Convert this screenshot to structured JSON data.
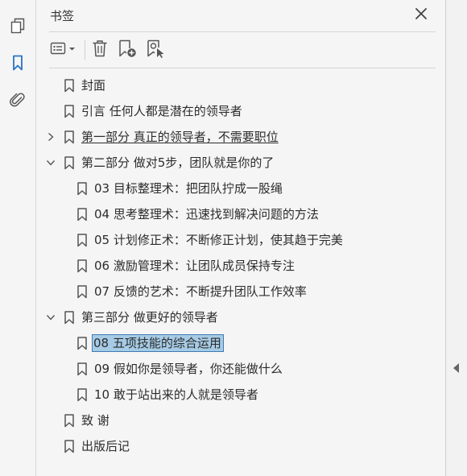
{
  "panel": {
    "title": "书签"
  },
  "bookmarks": [
    {
      "label": "封面",
      "level": 0,
      "caret": "none"
    },
    {
      "label": "引言 任何人都是潜在的领导者",
      "level": 0,
      "caret": "none"
    },
    {
      "label": "第一部分 真正的领导者，不需要职位",
      "level": 0,
      "caret": "collapsed",
      "underline": true
    },
    {
      "label": "第二部分 做对5步，团队就是你的了",
      "level": 0,
      "caret": "expanded"
    },
    {
      "label": "03 目标整理术：把团队拧成一股绳",
      "level": 1,
      "caret": "none"
    },
    {
      "label": "04 思考整理术：迅速找到解决问题的方法",
      "level": 1,
      "caret": "none"
    },
    {
      "label": "05 计划修正术：不断修正计划，使其趋于完美",
      "level": 1,
      "caret": "none"
    },
    {
      "label": "06 激励管理术：让团队成员保持专注",
      "level": 1,
      "caret": "none"
    },
    {
      "label": "07 反馈的艺术：不断提升团队工作效率",
      "level": 1,
      "caret": "none"
    },
    {
      "label": "第三部分 做更好的领导者",
      "level": 0,
      "caret": "expanded"
    },
    {
      "label": "08 五项技能的综合运用",
      "level": 1,
      "caret": "none",
      "selected": true
    },
    {
      "label": "09 假如你是领导者，你还能做什么",
      "level": 1,
      "caret": "none"
    },
    {
      "label": "10 敢于站出来的人就是领导者",
      "level": 1,
      "caret": "none"
    },
    {
      "label": "致 谢",
      "level": 0,
      "caret": "none"
    },
    {
      "label": "出版后记",
      "level": 0,
      "caret": "none"
    }
  ],
  "colors": {
    "selection": "#a6cbe6",
    "nav_accent": "#2b73c4"
  },
  "icons": {
    "left": [
      "pages-icon",
      "bookmarks-icon",
      "attachments-icon"
    ],
    "toolbar": [
      "options-menu-icon",
      "delete-bookmark-icon",
      "new-bookmark-icon",
      "bookmark-from-structure-icon"
    ]
  }
}
